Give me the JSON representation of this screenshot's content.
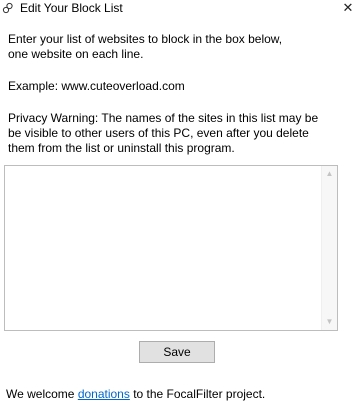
{
  "window": {
    "title": "Edit Your Block List",
    "close_glyph": "✕",
    "app_icon": "link-icon"
  },
  "instructions": {
    "line1": "Enter your list of websites to block in the box below,\none website on each line.",
    "example": "Example: www.cuteoverload.com",
    "warning": "Privacy Warning: The names of the sites in this list may be\nbe visible to other users of this PC, even after you delete\nthem from the list or uninstall this program."
  },
  "block_list": {
    "value": "",
    "placeholder": ""
  },
  "buttons": {
    "save_label": "Save"
  },
  "footer": {
    "prefix": "We welcome ",
    "link_text": "donations",
    "suffix": " to the FocalFilter project."
  },
  "scrollbar": {
    "up_glyph": "▲",
    "down_glyph": "▼"
  }
}
